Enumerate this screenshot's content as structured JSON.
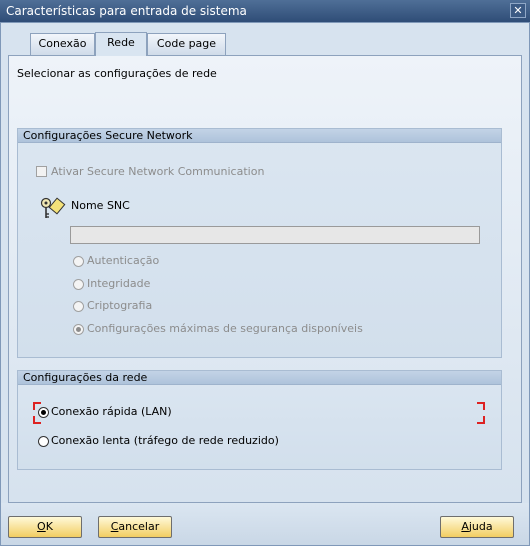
{
  "window": {
    "title": "Características para entrada de sistema",
    "close_glyph": "✕"
  },
  "tabs": [
    {
      "label": "Conexão",
      "active": false
    },
    {
      "label": "Rede",
      "active": true
    },
    {
      "label": "Code page",
      "active": false
    }
  ],
  "panel": {
    "title": "Selecionar as configurações de rede"
  },
  "secure_network": {
    "header": "Configurações Secure Network",
    "activate_label": "Ativar Secure Network Communication",
    "activate_checked": false,
    "snc_name_label": "Nome SNC",
    "snc_name_value": "",
    "options": [
      {
        "label": "Autenticação",
        "selected": false
      },
      {
        "label": "Integridade",
        "selected": false
      },
      {
        "label": "Criptografia",
        "selected": false
      },
      {
        "label": "Configurações máximas de segurança disponíveis",
        "selected": true
      }
    ]
  },
  "network": {
    "header": "Configurações da rede",
    "options": [
      {
        "label": "Conexão rápida (LAN)",
        "selected": true
      },
      {
        "label": "Conexão lenta (tráfego de rede reduzido)",
        "selected": false
      }
    ]
  },
  "buttons": {
    "ok": {
      "first": "O",
      "rest": "K"
    },
    "cancel": {
      "first": "C",
      "rest": "ancelar"
    },
    "help": {
      "first": "A",
      "rest": "juda"
    }
  },
  "colors": {
    "accent_button": "#f2cd61",
    "focus": "#dd2222",
    "titlebar": "#2f4d77"
  }
}
